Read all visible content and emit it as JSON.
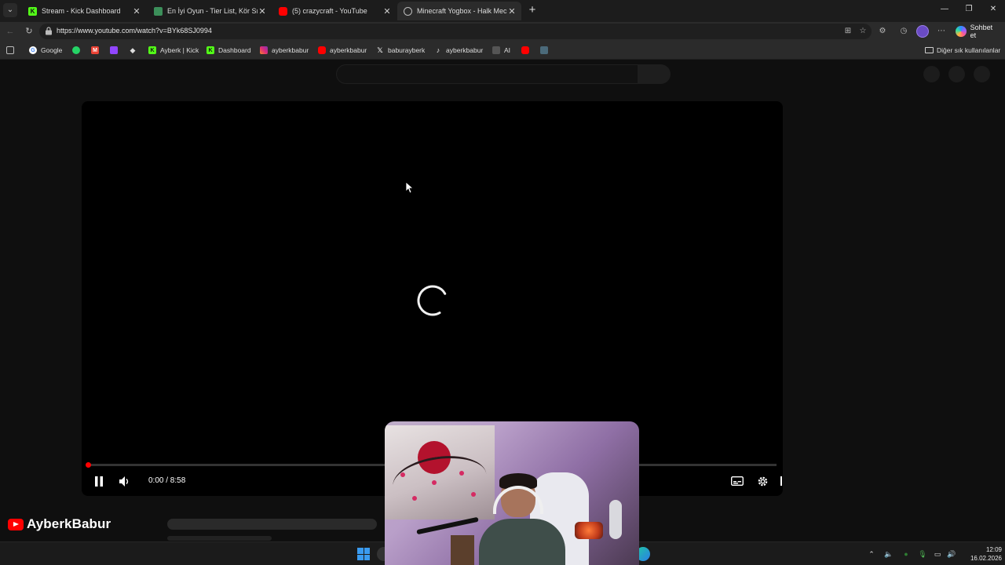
{
  "browser": {
    "tabs": [
      {
        "title": "Stream - Kick Dashboard",
        "active": false
      },
      {
        "title": "En İyi Oyun - Tier List, Kör Sıralama",
        "active": false
      },
      {
        "title": "(5) crazycraft - YouTube",
        "active": false
      },
      {
        "title": "Minecraft Yogbox - Halk Meclisi Tier List",
        "active": true
      }
    ],
    "url": "https://www.youtube.com/watch?v=BYk68SJ0994",
    "copilot_label": "Sohbet et",
    "bookmarks": [
      {
        "label": "Google",
        "icon": "google-icon"
      },
      {
        "label": "",
        "icon": "whatsapp-icon"
      },
      {
        "label": "",
        "icon": "gmail-icon"
      },
      {
        "label": "",
        "icon": "twitch-icon"
      },
      {
        "label": "",
        "icon": "diamond-icon"
      },
      {
        "label": "Ayberk | Kick",
        "icon": "kick-icon"
      },
      {
        "label": "Dashboard",
        "icon": "kick-icon"
      },
      {
        "label": "ayberkbabur",
        "icon": "instagram-icon"
      },
      {
        "label": "ayberkbabur",
        "icon": "youtube-icon"
      },
      {
        "label": "baburayberk",
        "icon": "x-icon"
      },
      {
        "label": "ayberkbabur",
        "icon": "tiktok-icon"
      },
      {
        "label": "AI",
        "icon": "ai-icon"
      },
      {
        "label": "",
        "icon": "youtube-icon"
      },
      {
        "label": "",
        "icon": "tool-icon"
      }
    ],
    "other_bookmarks_label": "Diğer sık kullanılanlar"
  },
  "player": {
    "time_current": "0:00",
    "time_total": "8:58",
    "time_display": "0:00 / 8:58",
    "progress_fraction": 0.0,
    "state": "loading"
  },
  "overlay": {
    "channel_name": "AyberkBabur"
  },
  "taskbar": {
    "time": "12:09",
    "date": "16.02.2026"
  },
  "colors": {
    "accent_red": "#ff0000",
    "kick_green": "#53fc18",
    "windows_blue": "#3a9bf0"
  }
}
